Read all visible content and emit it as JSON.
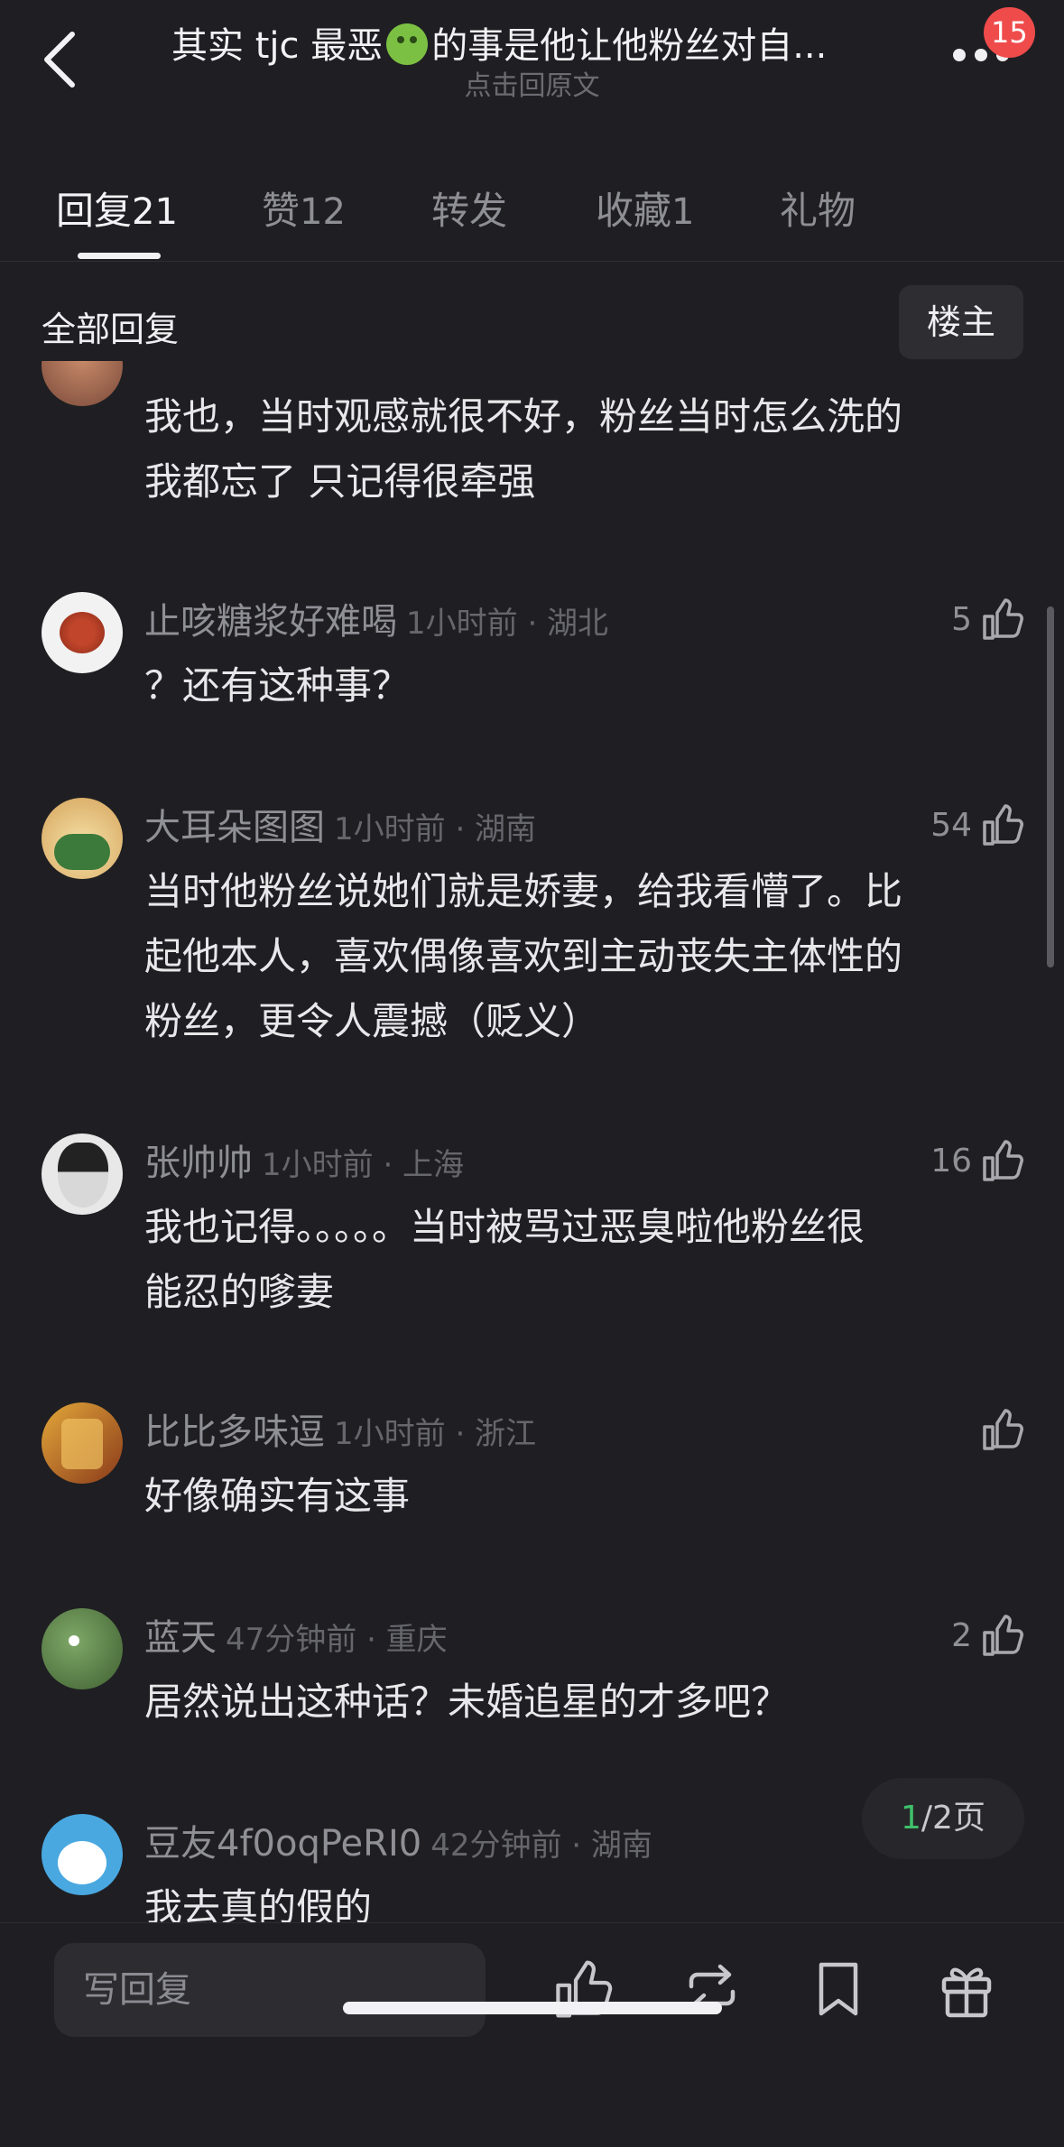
{
  "header": {
    "title_before_emoji": "其实 tjc 最恶",
    "title_after_emoji": "的事是他让他粉丝对自...",
    "subtitle": "点击回原文",
    "notification_count": "15"
  },
  "tabs": [
    {
      "label": "回复",
      "count": "21",
      "active": true
    },
    {
      "label": "赞",
      "count": "12",
      "active": false
    },
    {
      "label": "转发",
      "count": "",
      "active": false
    },
    {
      "label": "收藏",
      "count": "1",
      "active": false
    },
    {
      "label": "礼物",
      "count": "",
      "active": false
    }
  ],
  "filter": {
    "title": "全部回复",
    "op_button": "楼主"
  },
  "comments": [
    {
      "user": "",
      "time_location": "",
      "likes": "",
      "body": [
        "我也，当时观感就很不好，粉丝当时怎么洗的",
        "我都忘了 只记得很牵强"
      ]
    },
    {
      "user": "止咳糖浆好难喝",
      "time_location": "1小时前 · 湖北",
      "likes": "5",
      "body": [
        "？还有这种事？"
      ]
    },
    {
      "user": "大耳朵图图",
      "time_location": "1小时前 · 湖南",
      "likes": "54",
      "body": [
        "当时他粉丝说她们就是娇妻，给我看懵了。比",
        "起他本人，喜欢偶像喜欢到主动丧失主体性的",
        "粉丝，更令人震撼（贬义）"
      ]
    },
    {
      "user": "张帅帅",
      "time_location": "1小时前 · 上海",
      "likes": "16",
      "body": [
        "我也记得。。。。。当时被骂过恶臭啦他粉丝很",
        "能忍的嗲妻"
      ]
    },
    {
      "user": "比比多味逗",
      "time_location": "1小时前 · 浙江",
      "likes": "",
      "body": [
        "好像确实有这事"
      ]
    },
    {
      "user": "蓝天",
      "time_location": "47分钟前 · 重庆",
      "likes": "2",
      "body": [
        "居然说出这种话？未婚追星的才多吧？"
      ]
    },
    {
      "user": "豆友4f0oqPeRI0",
      "time_location": "42分钟前 · 湖南",
      "likes": "",
      "body": [
        "我去真的假的"
      ]
    }
  ],
  "pagination": {
    "current": "1",
    "total_text": "/2页"
  },
  "bottom_bar": {
    "reply_placeholder": "写回复"
  },
  "colors": {
    "background": "#1f1f23",
    "badge": "#ef4b4b",
    "accent_green": "#3fc06a"
  },
  "icons": [
    "back-arrow-icon",
    "more-dots-icon",
    "thumbs-up-icon",
    "repost-icon",
    "bookmark-icon",
    "gift-icon"
  ]
}
